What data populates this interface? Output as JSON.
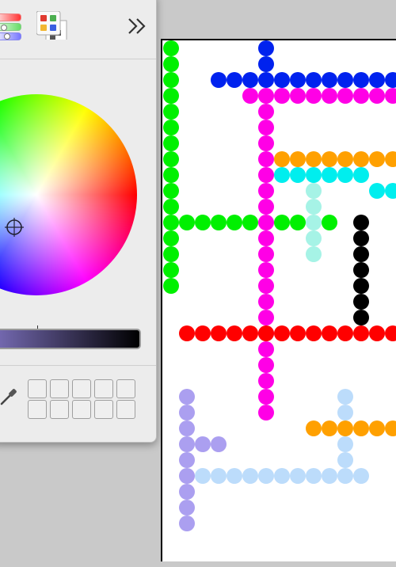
{
  "picker": {
    "toolbar": {
      "mode_icon": "color-palette-icon",
      "expand_icon": "chevron-double-right-icon"
    },
    "wheel_icon": "color-wheel",
    "brightness_slider": "brightness-slider",
    "eyedropper_icon": "eyedropper-icon",
    "swatch_rows": 2,
    "swatch_cols": 5
  },
  "colors": {
    "green": "#00f000",
    "blue": "#0022ee",
    "magenta": "#ff00e6",
    "orange": "#ffa000",
    "cyan": "#00eeee",
    "aqua": "#a6f3e6",
    "red": "#ff0000",
    "black": "#000000",
    "lavender": "#ab9ff0",
    "lightblue": "#bcdcfb"
  },
  "canvas_dots": [
    {
      "color": "green",
      "cells": [
        [
          0,
          0
        ],
        [
          0,
          1
        ],
        [
          0,
          2
        ],
        [
          0,
          3
        ],
        [
          0,
          4
        ],
        [
          0,
          5
        ],
        [
          0,
          6
        ],
        [
          0,
          7
        ],
        [
          0,
          8
        ],
        [
          0,
          9
        ],
        [
          0,
          10
        ],
        [
          0,
          11
        ],
        [
          0,
          12
        ],
        [
          0,
          13
        ],
        [
          0,
          14
        ],
        [
          0,
          15
        ],
        [
          1,
          11
        ],
        [
          2,
          11
        ],
        [
          3,
          11
        ],
        [
          4,
          11
        ],
        [
          5,
          11
        ],
        [
          7,
          11
        ],
        [
          8,
          11
        ],
        [
          10,
          11
        ]
      ]
    },
    {
      "color": "blue",
      "cells": [
        [
          6,
          0
        ],
        [
          6,
          1
        ],
        [
          3,
          2
        ],
        [
          4,
          2
        ],
        [
          5,
          2
        ],
        [
          6,
          2
        ],
        [
          7,
          2
        ],
        [
          8,
          2
        ],
        [
          9,
          2
        ],
        [
          10,
          2
        ],
        [
          11,
          2
        ],
        [
          12,
          2
        ],
        [
          13,
          2
        ],
        [
          14,
          2
        ]
      ]
    },
    {
      "color": "magenta",
      "cells": [
        [
          5,
          3
        ],
        [
          6,
          3
        ],
        [
          7,
          3
        ],
        [
          8,
          3
        ],
        [
          9,
          3
        ],
        [
          10,
          3
        ],
        [
          11,
          3
        ],
        [
          12,
          3
        ],
        [
          13,
          3
        ],
        [
          14,
          3
        ],
        [
          6,
          4
        ],
        [
          6,
          5
        ],
        [
          6,
          6
        ],
        [
          6,
          7
        ],
        [
          6,
          8
        ],
        [
          6,
          9
        ],
        [
          6,
          10
        ],
        [
          6,
          11
        ],
        [
          6,
          12
        ],
        [
          6,
          13
        ],
        [
          6,
          14
        ],
        [
          6,
          15
        ],
        [
          6,
          16
        ],
        [
          6,
          17
        ],
        [
          6,
          18
        ],
        [
          6,
          19
        ],
        [
          6,
          20
        ],
        [
          6,
          21
        ],
        [
          6,
          22
        ],
        [
          6,
          23
        ]
      ]
    },
    {
      "color": "orange",
      "cells": [
        [
          7,
          7
        ],
        [
          8,
          7
        ],
        [
          9,
          7
        ],
        [
          10,
          7
        ],
        [
          11,
          7
        ],
        [
          12,
          7
        ],
        [
          13,
          7
        ],
        [
          14,
          7
        ],
        [
          9,
          24
        ],
        [
          10,
          24
        ],
        [
          11,
          24
        ],
        [
          12,
          24
        ],
        [
          13,
          24
        ],
        [
          14,
          24
        ]
      ]
    },
    {
      "color": "cyan",
      "cells": [
        [
          7,
          8
        ],
        [
          8,
          8
        ],
        [
          9,
          8
        ],
        [
          10,
          8
        ],
        [
          11,
          8
        ],
        [
          12,
          8
        ],
        [
          13,
          9
        ],
        [
          14,
          9
        ]
      ]
    },
    {
      "color": "aqua",
      "cells": [
        [
          9,
          9
        ],
        [
          9,
          10
        ],
        [
          9,
          11
        ],
        [
          9,
          12
        ],
        [
          9,
          13
        ]
      ]
    },
    {
      "color": "black",
      "cells": [
        [
          12,
          11
        ],
        [
          12,
          12
        ],
        [
          12,
          13
        ],
        [
          12,
          14
        ],
        [
          12,
          15
        ],
        [
          12,
          16
        ],
        [
          12,
          17
        ]
      ]
    },
    {
      "color": "red",
      "cells": [
        [
          1,
          18
        ],
        [
          2,
          18
        ],
        [
          3,
          18
        ],
        [
          4,
          18
        ],
        [
          5,
          18
        ],
        [
          6,
          18
        ],
        [
          7,
          18
        ],
        [
          8,
          18
        ],
        [
          9,
          18
        ],
        [
          10,
          18
        ],
        [
          11,
          18
        ],
        [
          12,
          18
        ],
        [
          13,
          18
        ],
        [
          14,
          18
        ]
      ]
    },
    {
      "color": "lightblue",
      "cells": [
        [
          11,
          22
        ],
        [
          11,
          23
        ],
        [
          11,
          25
        ],
        [
          11,
          26
        ],
        [
          2,
          27
        ],
        [
          3,
          27
        ],
        [
          4,
          27
        ],
        [
          5,
          27
        ],
        [
          6,
          27
        ],
        [
          7,
          27
        ],
        [
          8,
          27
        ],
        [
          9,
          27
        ],
        [
          10,
          27
        ],
        [
          11,
          27
        ],
        [
          12,
          27
        ]
      ]
    },
    {
      "color": "lavender",
      "cells": [
        [
          1,
          22
        ],
        [
          1,
          23
        ],
        [
          1,
          24
        ],
        [
          1,
          25
        ],
        [
          2,
          25
        ],
        [
          3,
          25
        ],
        [
          1,
          26
        ],
        [
          1,
          27
        ],
        [
          1,
          28
        ],
        [
          1,
          29
        ],
        [
          1,
          30
        ]
      ]
    }
  ]
}
